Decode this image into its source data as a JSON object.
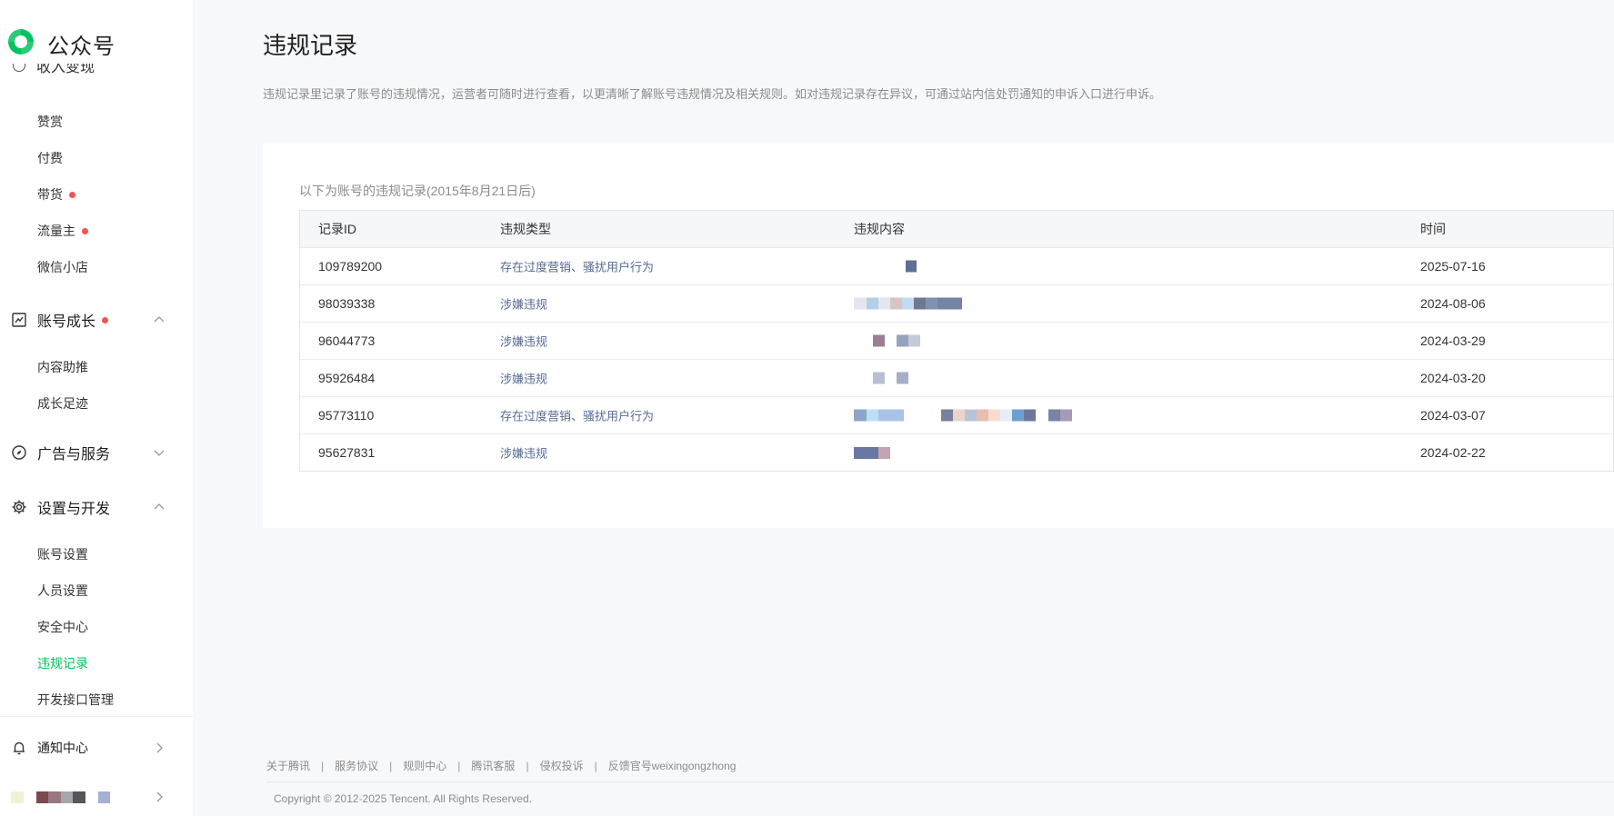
{
  "brand": {
    "name": "公众号"
  },
  "sidebar": {
    "clipped_group_label": "收入变现",
    "income_items": [
      {
        "label": "赞赏",
        "dot": false
      },
      {
        "label": "付费",
        "dot": false
      },
      {
        "label": "带货",
        "dot": true
      },
      {
        "label": "流量主",
        "dot": true
      },
      {
        "label": "微信小店",
        "dot": false
      }
    ],
    "growth": {
      "label": "账号成长",
      "dot": true,
      "expanded": true,
      "items": [
        {
          "label": "内容助推"
        },
        {
          "label": "成长足迹"
        }
      ]
    },
    "ads": {
      "label": "广告与服务",
      "expanded": false
    },
    "settings": {
      "label": "设置与开发",
      "expanded": true,
      "items": [
        {
          "label": "账号设置"
        },
        {
          "label": "人员设置"
        },
        {
          "label": "安全中心"
        },
        {
          "label": "违规记录",
          "active": true
        },
        {
          "label": "开发接口管理"
        }
      ]
    },
    "notify": {
      "label": "通知中心"
    }
  },
  "page": {
    "title": "违规记录",
    "description": "违规记录里记录了账号的违规情况，运营者可随时进行查看，以更清晰了解账号违规情况及相关规则。如对违规记录存在异议，可通过站内信处罚通知的申诉入口进行申诉。"
  },
  "records": {
    "caption": "以下为账号的违规记录(2015年8月21日后)",
    "columns": {
      "id": "记录ID",
      "type": "违规类型",
      "content": "违规内容",
      "time": "时间"
    },
    "rows": [
      {
        "id": "109789200",
        "type": "存在过度营销、骚扰用户行为",
        "time": "2025-07-16"
      },
      {
        "id": "98039338",
        "type": "涉嫌违规",
        "time": "2024-08-06"
      },
      {
        "id": "96044773",
        "type": "涉嫌违规",
        "time": "2024-03-29"
      },
      {
        "id": "95926484",
        "type": "涉嫌违规",
        "time": "2024-03-20"
      },
      {
        "id": "95773110",
        "type": "存在过度营销、骚扰用户行为",
        "time": "2024-03-07"
      },
      {
        "id": "95627831",
        "type": "涉嫌违规",
        "time": "2024-02-22"
      }
    ]
  },
  "footer": {
    "links": [
      "关于腾讯",
      "服务协议",
      "规则中心",
      "腾讯客服",
      "侵权投诉",
      "反馈官号weixingongzhong"
    ],
    "separator": "|",
    "copyright": "Copyright © 2012-2025 Tencent. All Rights Reserved."
  },
  "colors": {
    "accent": "#07c160",
    "link": "#576b95",
    "badge": "#fa5151"
  },
  "icons": {
    "logo": "wechat-official-logo",
    "growth": "trend-chart-icon",
    "ads": "compass-icon",
    "settings": "gear-icon",
    "notify": "bell-icon",
    "expand": "chevron-up-icon",
    "collapse": "chevron-down-icon",
    "enter": "chevron-right-icon"
  }
}
